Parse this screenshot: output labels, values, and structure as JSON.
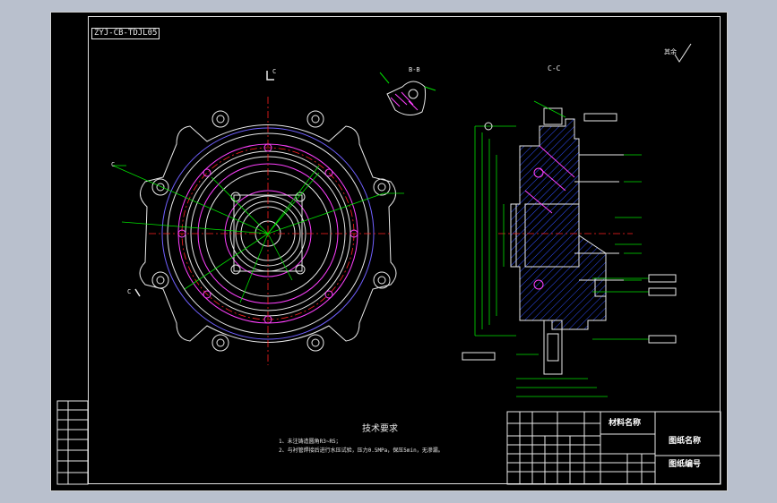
{
  "drawing": {
    "code_label": "ZYJ-CB-TDJL05",
    "roughness_label": "其余",
    "section_bb_label": "B-B",
    "section_cc_label": "C-C",
    "section_c_top": "C",
    "section_c_left": "C",
    "section_c_bottom": "C"
  },
  "tech_requirements": {
    "title": "技术要求",
    "lines": [
      "1、未注铸造圆角R3~R5；",
      "2、与衬管焊接后进行水压试验，压力0.5MPa，保压5min，无渗漏。"
    ]
  },
  "title_block": {
    "material_label": "材料名称",
    "drawing_name_label": "图纸名称",
    "drawing_number_label": "图纸编号"
  },
  "colors": {
    "background": "#000000",
    "outer_bg": "#b9c0cd",
    "line_white": "#e8e8e8",
    "dimension_green": "#00e000",
    "center_red": "#ff2020",
    "hidden_magenta": "#ff40ff",
    "outline_purple": "#7060ff"
  }
}
